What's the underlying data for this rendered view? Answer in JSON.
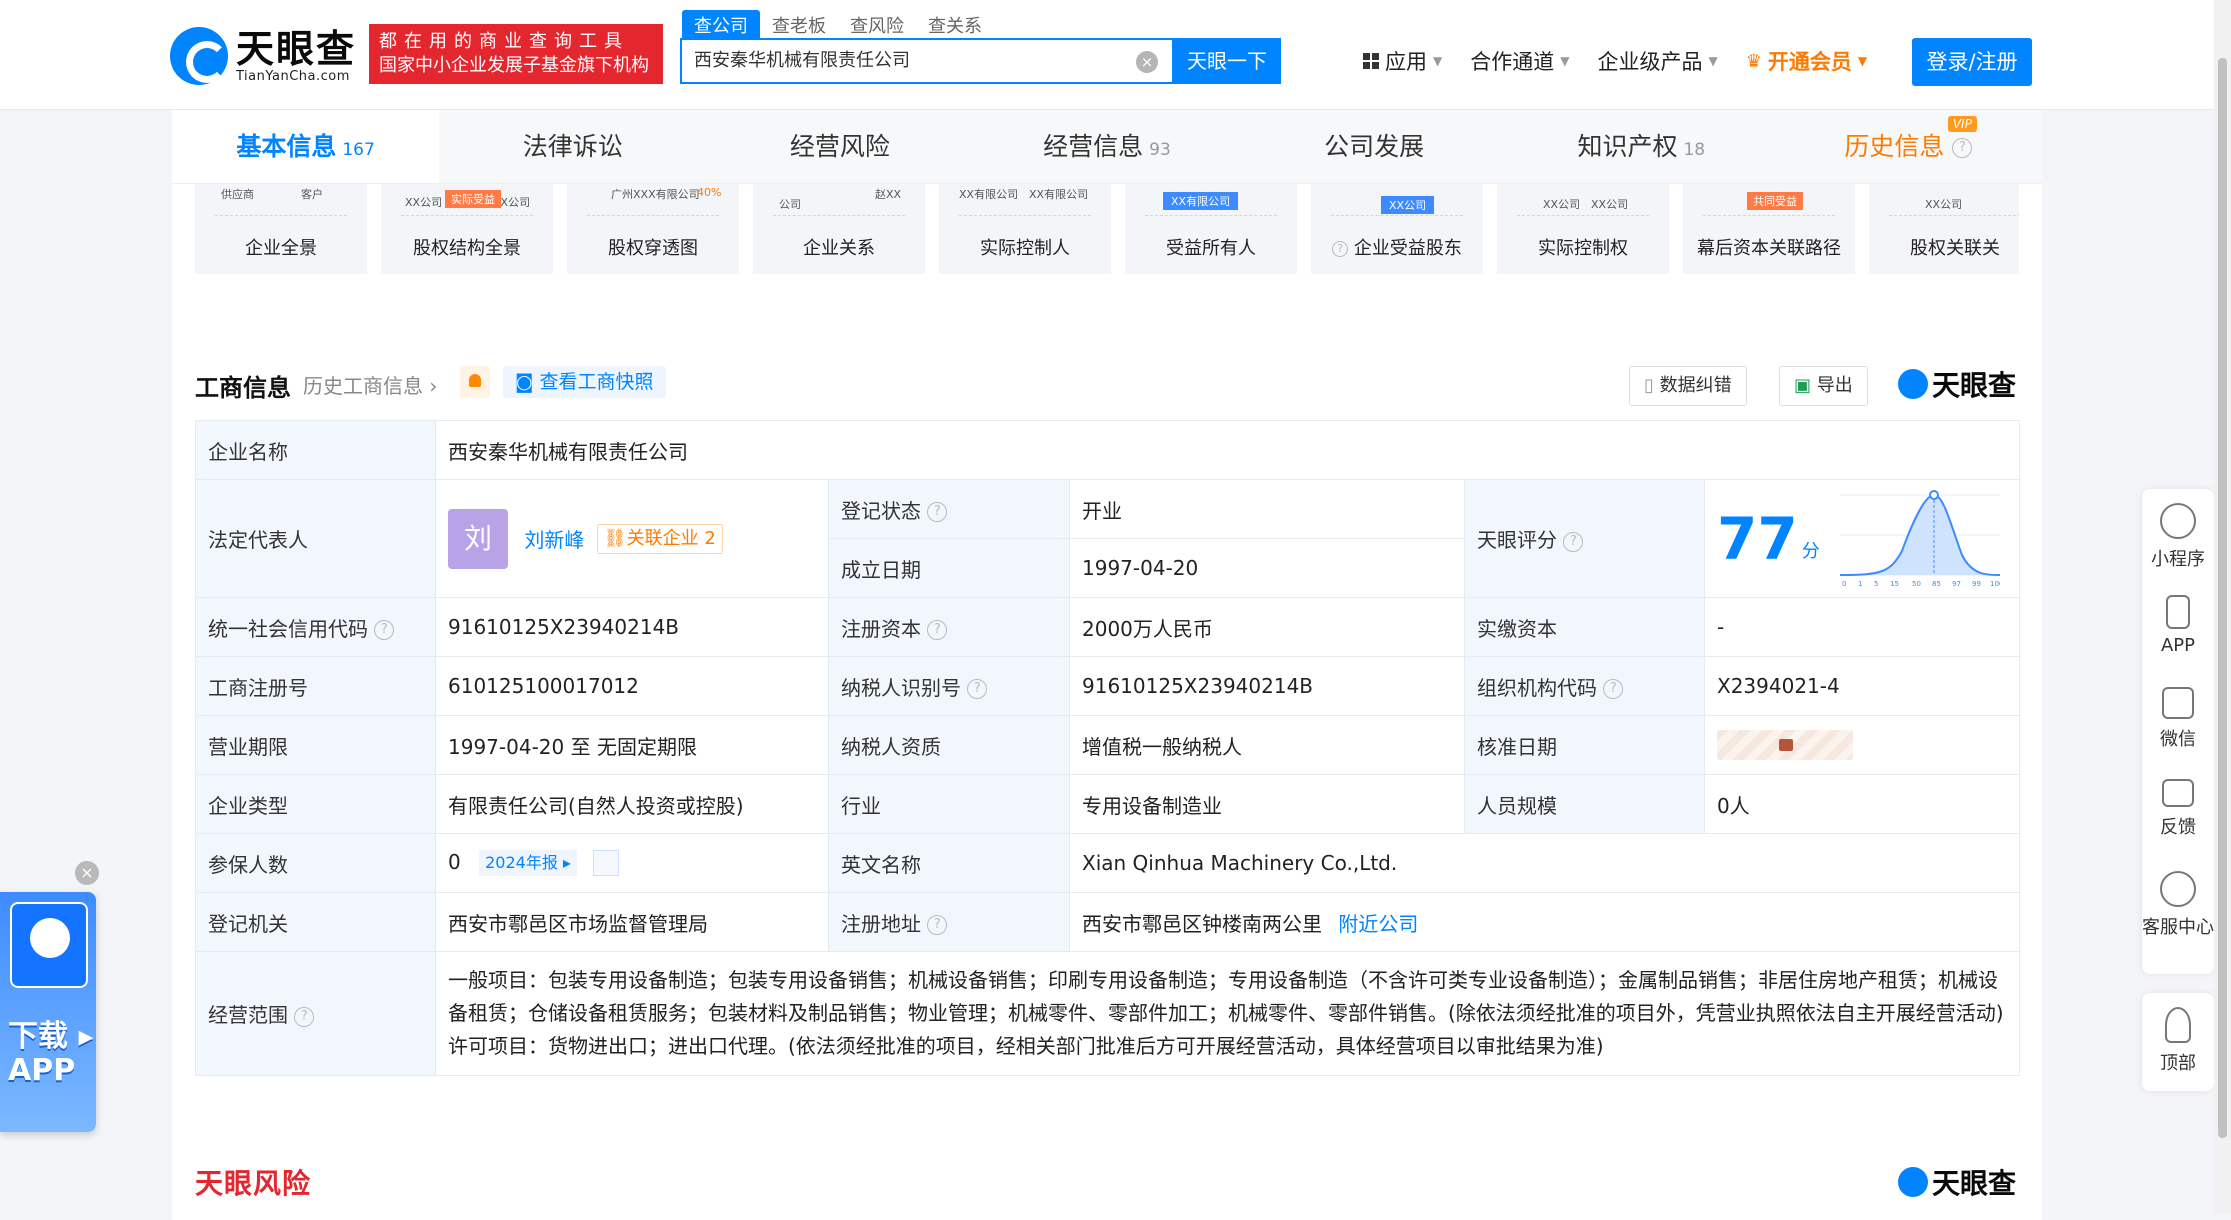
{
  "header": {
    "logo_cn": "天眼查",
    "logo_en": "TianYanCha.com",
    "slogan_line1": "都在用的商业查询工具",
    "slogan_line2": "国家中小企业发展子基金旗下机构",
    "search_tabs": [
      "查公司",
      "查老板",
      "查风险",
      "查关系"
    ],
    "search_value": "西安秦华机械有限责任公司",
    "search_button": "天眼一下",
    "nav": [
      "应用",
      "合作通道",
      "企业级产品"
    ],
    "vip_label": "开通会员",
    "login_label": "登录/注册"
  },
  "main_tabs": [
    {
      "label": "基本信息",
      "count": "167"
    },
    {
      "label": "法律诉讼",
      "count": ""
    },
    {
      "label": "经营风险",
      "count": ""
    },
    {
      "label": "经营信息",
      "count": "93"
    },
    {
      "label": "公司发展",
      "count": ""
    },
    {
      "label": "知识产权",
      "count": "18"
    },
    {
      "label": "历史信息",
      "count": ""
    }
  ],
  "vip_badge": "VIP",
  "graph_cards": [
    {
      "label": "企业全景",
      "thumb": [
        "供应商",
        "客户"
      ]
    },
    {
      "label": "股权结构全景",
      "thumb": [
        "XX公司",
        "XX公司",
        "实际受益"
      ]
    },
    {
      "label": "股权穿透图",
      "thumb": [
        "广州XXX有限公司",
        "40%"
      ]
    },
    {
      "label": "企业关系",
      "thumb": [
        "公司",
        "赵XX"
      ]
    },
    {
      "label": "实际控制人",
      "thumb": [
        "XX有限公司",
        "XX有限公司"
      ]
    },
    {
      "label": "受益所有人",
      "thumb": [
        "XX有限公司"
      ]
    },
    {
      "label": "企业受益股东",
      "thumb": [
        "XX公司"
      ]
    },
    {
      "label": "实际控制权",
      "thumb": [
        "XX公司",
        "XX公司"
      ]
    },
    {
      "label": "幕后资本关联路径",
      "thumb": [
        "共同受益"
      ]
    },
    {
      "label": "股权关联关",
      "thumb": [
        "XX公司"
      ]
    }
  ],
  "section": {
    "title": "工商信息",
    "sub": "历史工商信息",
    "snapshot": "查看工商快照",
    "correct": "数据纠错",
    "export": "导出",
    "watermark": "天眼查"
  },
  "info": {
    "company_name_k": "企业名称",
    "company_name_v": "西安秦华机械有限责任公司",
    "legal_k": "法定代表人",
    "legal_avatar": "刘",
    "legal_name": "刘新峰",
    "related_label": "关联企业",
    "related_count": "2",
    "status_k": "登记状态",
    "status_v": "开业",
    "found_k": "成立日期",
    "found_v": "1997-04-20",
    "score_k": "天眼评分",
    "score_v": "77",
    "score_unit": "分",
    "score_axis": [
      "0",
      "1",
      "5",
      "15",
      "50",
      "85",
      "97",
      "99",
      "100"
    ],
    "credit_k": "统一社会信用代码",
    "credit_v": "91610125X23940214B",
    "reg_cap_k": "注册资本",
    "reg_cap_v": "2000万人民币",
    "paid_cap_k": "实缴资本",
    "paid_cap_v": "-",
    "reg_no_k": "工商注册号",
    "reg_no_v": "610125100017012",
    "tax_id_k": "纳税人识别号",
    "tax_id_v": "91610125X23940214B",
    "org_code_k": "组织机构代码",
    "org_code_v": "X2394021-4",
    "term_k": "营业期限",
    "term_v": "1997-04-20 至 无固定期限",
    "tax_qual_k": "纳税人资质",
    "tax_qual_v": "增值税一般纳税人",
    "approve_k": "核准日期",
    "type_k": "企业类型",
    "type_v": "有限责任公司(自然人投资或控股)",
    "industry_k": "行业",
    "industry_v": "专用设备制造业",
    "staff_k": "人员规模",
    "staff_v": "0人",
    "insured_k": "参保人数",
    "insured_v": "0",
    "report_label": "2024年报",
    "en_name_k": "英文名称",
    "en_name_v": "Xian Qinhua Machinery Co.,Ltd.",
    "authority_k": "登记机关",
    "authority_v": "西安市鄠邑区市场监督管理局",
    "address_k": "注册地址",
    "address_v": "西安市鄠邑区钟楼南两公里",
    "nearby_label": "附近公司",
    "scope_k": "经营范围",
    "scope_v": "一般项目：包装专用设备制造；包装专用设备销售；机械设备销售；印刷专用设备制造；专用设备制造（不含许可类专业设备制造）；金属制品销售；非居住房地产租赁；机械设备租赁；仓储设备租赁服务；包装材料及制品销售；物业管理；机械零件、零部件加工；机械零件、零部件销售。(除依法须经批准的项目外，凭营业执照依法自主开展经营活动)许可项目：货物进出口；进出口代理。(依法须经批准的项目，经相关部门批准后方可开展经营活动，具体经营项目以审批结果为准)"
  },
  "risk": {
    "title": "天眼风险",
    "logo": "天眼查"
  },
  "right_bar": [
    "小程序",
    "APP",
    "微信",
    "反馈",
    "客服中心"
  ],
  "top_label": "顶部",
  "download": {
    "line1": "下载 ▸",
    "line2": "APP"
  }
}
